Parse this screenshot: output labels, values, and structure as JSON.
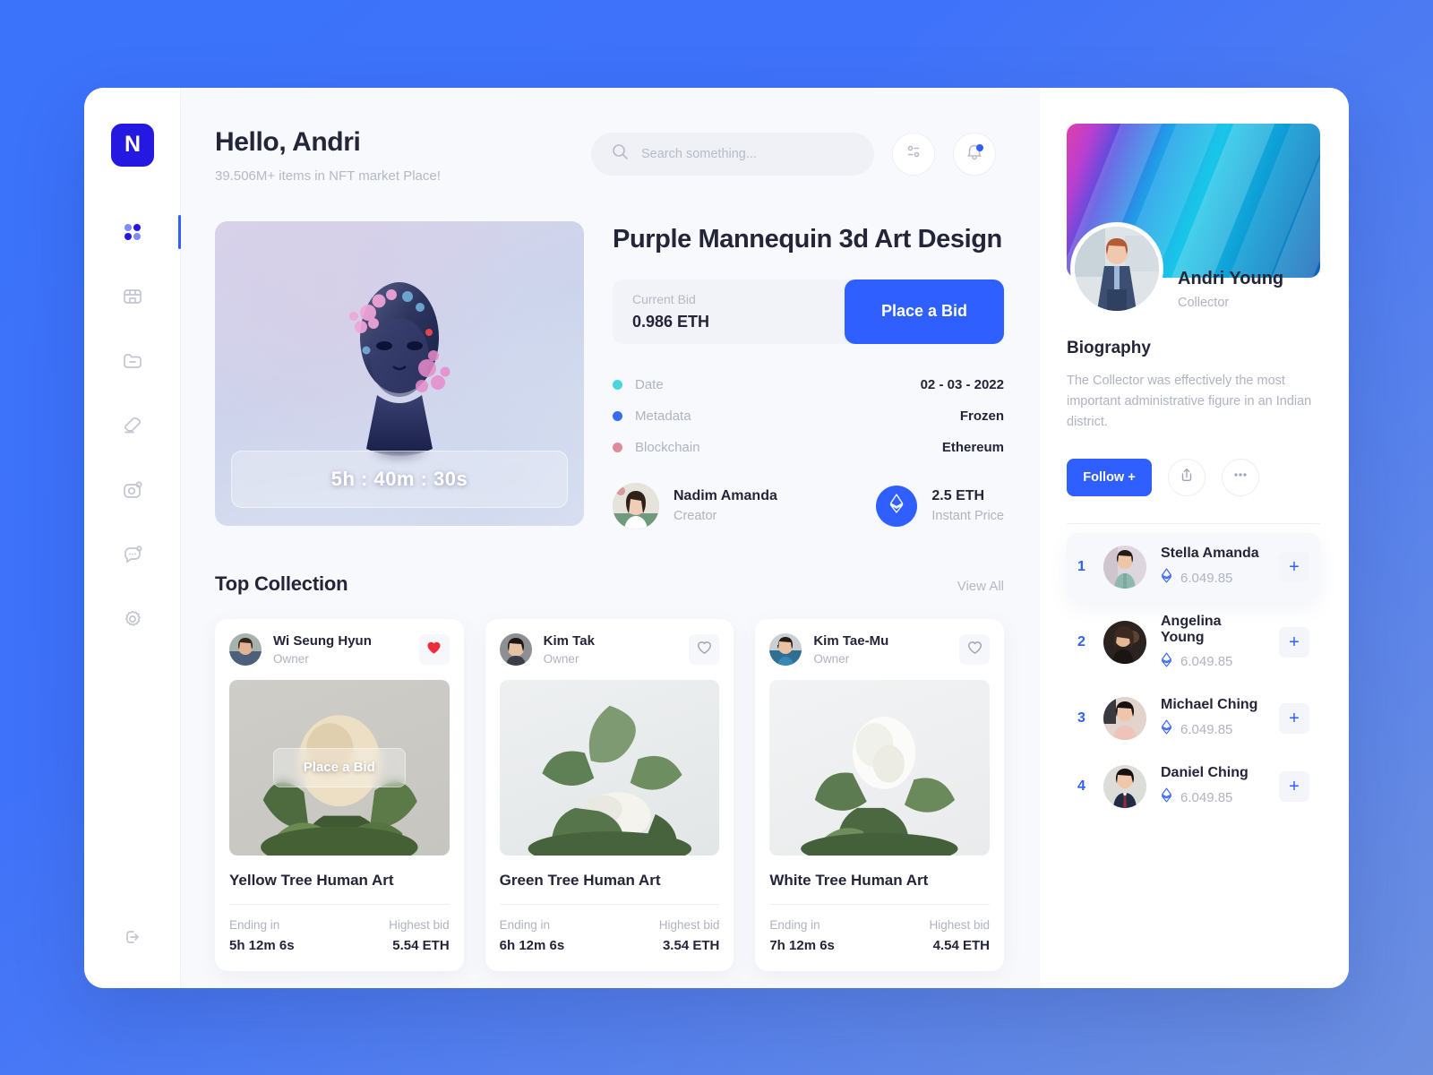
{
  "brand": {
    "logo_letter": "N"
  },
  "sidebar": {
    "items": [
      {
        "name": "dashboard",
        "icon": "grid-icon",
        "active": true
      },
      {
        "name": "marketplace",
        "icon": "store-icon",
        "active": false
      },
      {
        "name": "collections",
        "icon": "folder-minus-icon",
        "active": false
      },
      {
        "name": "tags",
        "icon": "eraser-icon",
        "active": false
      },
      {
        "name": "gallery",
        "icon": "camera-icon",
        "active": false
      },
      {
        "name": "messages",
        "icon": "chat-icon",
        "active": false
      },
      {
        "name": "settings",
        "icon": "gear-icon",
        "active": false
      }
    ],
    "logout": {
      "name": "logout",
      "icon": "logout-icon"
    }
  },
  "header": {
    "greeting": "Hello, Andri",
    "subtitle": "39.506M+ items in NFT market Place!",
    "search": {
      "value": "",
      "placeholder": "Search something..."
    },
    "filter_icon": "sliders-icon",
    "notification_icon": "bell-icon",
    "has_notification": true
  },
  "featured": {
    "title": "Purple Mannequin 3d Art Design",
    "timer": "5h : 40m : 30s",
    "bid_label": "Current Bid",
    "bid_value": "0.986 ETH",
    "bid_button": "Place a Bid",
    "meta": [
      {
        "key": "Date",
        "value": "02 - 03 - 2022",
        "color": "#4ad6dd"
      },
      {
        "key": "Metadata",
        "value": "Frozen",
        "color": "#3a6bf5"
      },
      {
        "key": "Blockchain",
        "value": "Ethereum",
        "color": "#e08a9a"
      }
    ],
    "creator": {
      "name": "Nadim Amanda",
      "role": "Creator"
    },
    "instant": {
      "price": "2.5 ETH",
      "label": "Instant Price",
      "icon": "ethereum-icon"
    }
  },
  "collection": {
    "title": "Top Collection",
    "view_all": "View All",
    "labels": {
      "ending": "Ending in",
      "highest": "Highest bid",
      "owner": "Owner",
      "bid_overlay": "Place a Bid"
    },
    "cards": [
      {
        "owner": "Wi Seung Hyun",
        "role": "Owner",
        "liked": true,
        "name": "Yellow Tree Human Art",
        "ending_in": "5h 12m 6s",
        "highest_bid": "5.54 ETH",
        "overlay": "Place a Bid"
      },
      {
        "owner": "Kim Tak",
        "role": "Owner",
        "liked": false,
        "name": "Green Tree Human Art",
        "ending_in": "6h 12m 6s",
        "highest_bid": "3.54 ETH",
        "overlay": ""
      },
      {
        "owner": "Kim Tae-Mu",
        "role": "Owner",
        "liked": false,
        "name": "White Tree Human Art",
        "ending_in": "7h 12m 6s",
        "highest_bid": "4.54 ETH",
        "overlay": ""
      }
    ]
  },
  "profile": {
    "name": "Andri Young",
    "role": "Collector",
    "bio_title": "Biography",
    "bio_text": "The Collector was effectively the most important administrative figure in an Indian district.",
    "follow_label": "Follow +",
    "share_icon": "share-icon",
    "more_icon": "more-icon"
  },
  "ranking": [
    {
      "rank": "1",
      "name": "Stella Amanda",
      "amount": "6.049.85",
      "highlight": true
    },
    {
      "rank": "2",
      "name": "Angelina Young",
      "amount": "6.049.85",
      "highlight": false
    },
    {
      "rank": "3",
      "name": "Michael Ching",
      "amount": "6.049.85",
      "highlight": false
    },
    {
      "rank": "4",
      "name": "Daniel Ching",
      "amount": "6.049.85",
      "highlight": false
    }
  ],
  "colors": {
    "accent": "#2f5fff",
    "logo_bg": "#2518e0",
    "page_bg": "#3b73fb",
    "text": "#242539",
    "muted": "#b0b3c2"
  }
}
